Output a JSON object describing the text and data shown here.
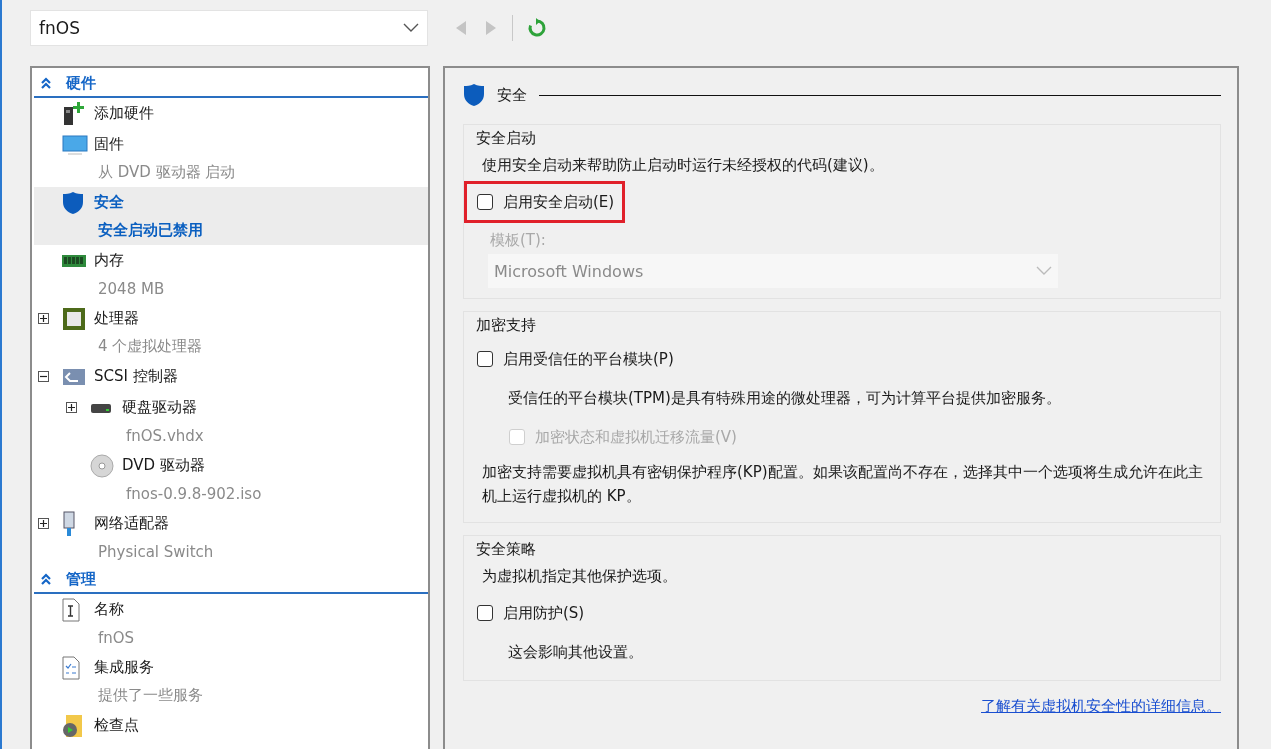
{
  "vm_selector": {
    "value": "fnOS"
  },
  "tree": [
    {
      "title": "硬件",
      "expanded": true,
      "items": [
        {
          "name": "添加硬件",
          "kind": "add-hardware",
          "selected": false
        },
        {
          "name": "固件",
          "detail": "从 DVD 驱动器 启动",
          "kind": "firmware",
          "selected": false
        },
        {
          "name": "安全",
          "detail": "安全启动已禁用",
          "kind": "security",
          "selected": true
        },
        {
          "name": "内存",
          "detail": "2048 MB",
          "kind": "memory",
          "selected": false
        },
        {
          "name": "处理器",
          "detail": "4 个虚拟处理器",
          "kind": "processor",
          "expanded": false,
          "selected": false
        },
        {
          "name": "SCSI 控制器",
          "kind": "controller",
          "expanded": true,
          "selected": false,
          "children": [
            {
              "name": "硬盘驱动器",
              "detail": "fnOS.vhdx",
              "kind": "disk",
              "expanded": false,
              "selected": false
            },
            {
              "name": "DVD 驱动器",
              "detail": "fnos-0.9.8-902.iso",
              "kind": "dvd",
              "selected": false
            }
          ]
        },
        {
          "name": "网络适配器",
          "detail": "Physical Switch",
          "kind": "network",
          "expanded": false,
          "selected": false
        }
      ]
    },
    {
      "title": "管理",
      "expanded": true,
      "items": [
        {
          "name": "名称",
          "detail": "fnOS",
          "kind": "name",
          "selected": false
        },
        {
          "name": "集成服务",
          "detail": "提供了一些服务",
          "kind": "services",
          "selected": false
        },
        {
          "name": "检查点",
          "kind": "checkpoint",
          "selected": false
        }
      ]
    }
  ],
  "settings": {
    "title": "安全",
    "groups": [
      {
        "title": "安全启动",
        "content": [
          {
            "kind": "text",
            "text": "使用安全启动来帮助防止启动时运行未经授权的代码(建议)。"
          },
          {
            "kind": "checkbox",
            "label": "启用安全启动(E)",
            "checked": false,
            "disabled": false,
            "highlighted": true
          },
          {
            "kind": "select",
            "label": "模板(T):",
            "value": "Microsoft Windows",
            "disabled": true
          }
        ]
      },
      {
        "title": "加密支持",
        "content": [
          {
            "kind": "checkbox",
            "label": "启用受信任的平台模块(P)",
            "checked": false,
            "disabled": false,
            "highlighted": false
          },
          {
            "kind": "note",
            "text": "受信任的平台模块(TPM)是具有特殊用途的微处理器，可为计算平台提供加密服务。"
          },
          {
            "kind": "subcheckbox",
            "label": "加密状态和虚拟机迁移流量(V)",
            "checked": false,
            "disabled": true,
            "highlighted": false
          },
          {
            "kind": "text",
            "text": "加密支持需要虚拟机具有密钥保护程序(KP)配置。如果该配置尚不存在，选择其中一个选项将生成允许在此主机上运行虚拟机的 KP。"
          }
        ]
      },
      {
        "title": "安全策略",
        "content": [
          {
            "kind": "text",
            "text": "为虚拟机指定其他保护选项。"
          },
          {
            "kind": "checkbox",
            "label": "启用防护(S)",
            "checked": false,
            "disabled": false,
            "highlighted": false
          },
          {
            "kind": "note",
            "text": "这会影响其他设置。"
          }
        ]
      }
    ],
    "link": "了解有关虚拟机安全性的详细信息。"
  }
}
